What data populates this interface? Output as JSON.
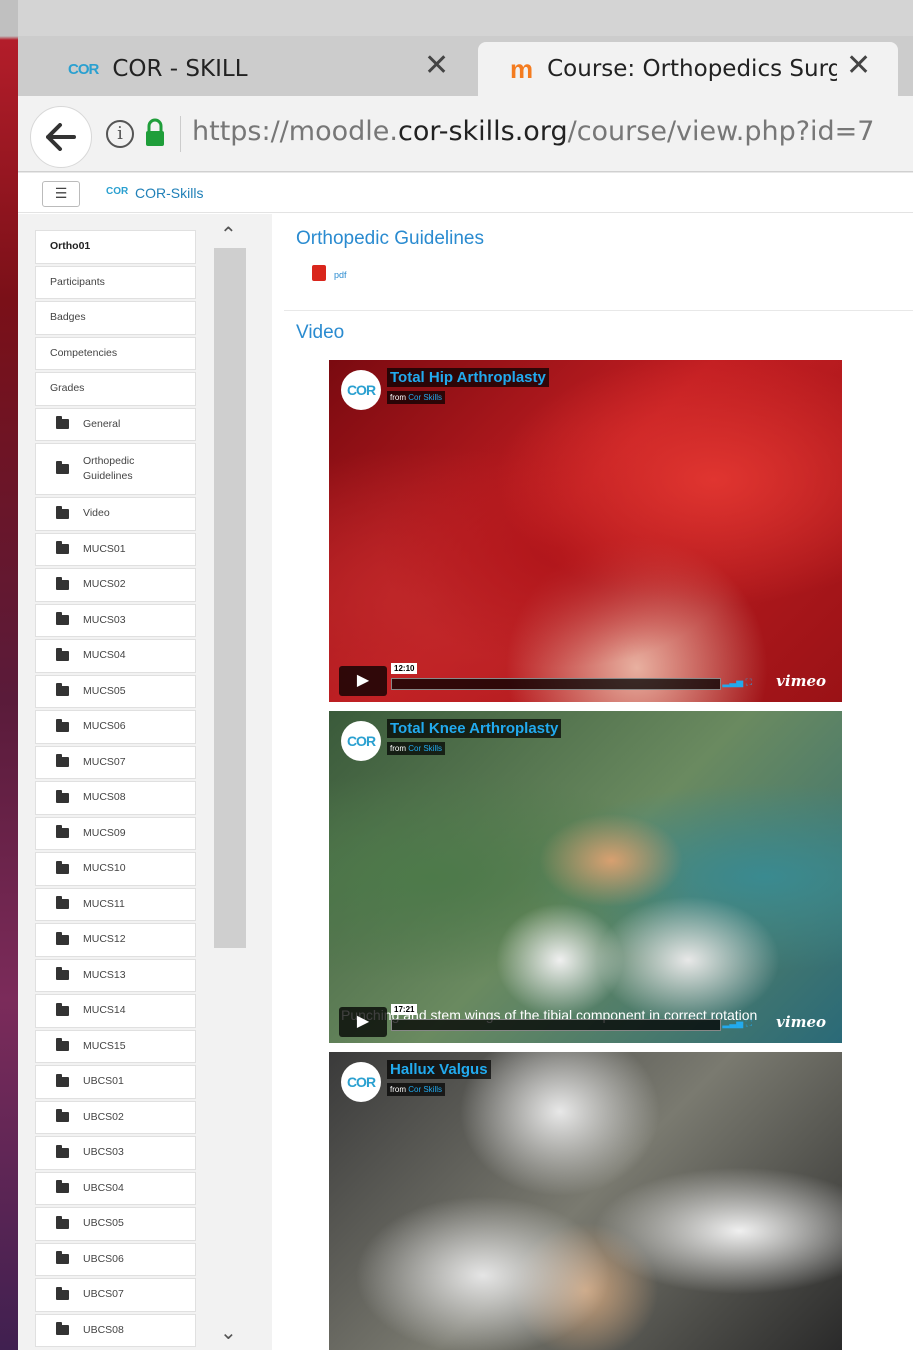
{
  "browser": {
    "tabs": [
      {
        "title": "COR - SKILL",
        "icon": "cor-logo-icon",
        "logo_text": "COR"
      },
      {
        "title": "Course: Orthopedics Surgery",
        "icon": "moodle-icon",
        "logo_text": "m"
      }
    ],
    "close_glyph": "✕",
    "url_prefix": "https://moodle.",
    "url_domain": "cor-skills.org",
    "url_path": "/course/view.php?id=7"
  },
  "navbar": {
    "menu_glyph": "☰",
    "logo_text": "COR",
    "site_name": "COR-Skills"
  },
  "drawer": {
    "items": [
      {
        "label": "Ortho01",
        "type": "link"
      },
      {
        "label": "Participants",
        "type": "link"
      },
      {
        "label": "Badges",
        "type": "link"
      },
      {
        "label": "Competencies",
        "type": "link"
      },
      {
        "label": "Grades",
        "type": "link"
      },
      {
        "label": "General",
        "type": "folder"
      },
      {
        "label": "Orthopedic Guidelines",
        "type": "folder"
      },
      {
        "label": "Video",
        "type": "folder"
      },
      {
        "label": "MUCS01",
        "type": "folder"
      },
      {
        "label": "MUCS02",
        "type": "folder"
      },
      {
        "label": "MUCS03",
        "type": "folder"
      },
      {
        "label": "MUCS04",
        "type": "folder"
      },
      {
        "label": "MUCS05",
        "type": "folder"
      },
      {
        "label": "MUCS06",
        "type": "folder"
      },
      {
        "label": "MUCS07",
        "type": "folder"
      },
      {
        "label": "MUCS08",
        "type": "folder"
      },
      {
        "label": "MUCS09",
        "type": "folder"
      },
      {
        "label": "MUCS10",
        "type": "folder"
      },
      {
        "label": "MUCS11",
        "type": "folder"
      },
      {
        "label": "MUCS12",
        "type": "folder"
      },
      {
        "label": "MUCS13",
        "type": "folder"
      },
      {
        "label": "MUCS14",
        "type": "folder"
      },
      {
        "label": "MUCS15",
        "type": "folder"
      },
      {
        "label": "UBCS01",
        "type": "folder"
      },
      {
        "label": "UBCS02",
        "type": "folder"
      },
      {
        "label": "UBCS03",
        "type": "folder"
      },
      {
        "label": "UBCS04",
        "type": "folder"
      },
      {
        "label": "UBCS05",
        "type": "folder"
      },
      {
        "label": "UBCS06",
        "type": "folder"
      },
      {
        "label": "UBCS07",
        "type": "folder"
      },
      {
        "label": "UBCS08",
        "type": "folder"
      }
    ]
  },
  "main": {
    "section1_title": "Orthopedic Guidelines",
    "pdf_label": "pdf",
    "section2_title": "Video",
    "videos": [
      {
        "title": "Total Hip Arthroplasty",
        "from_label": "from",
        "channel": "Cor Skills",
        "logo_text": "COR",
        "duration": "12:10",
        "caption": "",
        "vimeo": "vimeo"
      },
      {
        "title": "Total Knee Arthroplasty",
        "from_label": "from",
        "channel": "Cor Skills",
        "logo_text": "COR",
        "duration": "17:21",
        "caption": "Punching and stem wings of the tibial component in correct rotation",
        "vimeo": "vimeo"
      },
      {
        "title": "Hallux Valgus",
        "from_label": "from",
        "channel": "Cor Skills",
        "logo_text": "COR",
        "duration": "",
        "caption": "",
        "vimeo": ""
      }
    ]
  },
  "colors": {
    "link": "#2a8bd0",
    "vimeo_accent": "#22aaee",
    "moodle_orange": "#f47c20"
  }
}
